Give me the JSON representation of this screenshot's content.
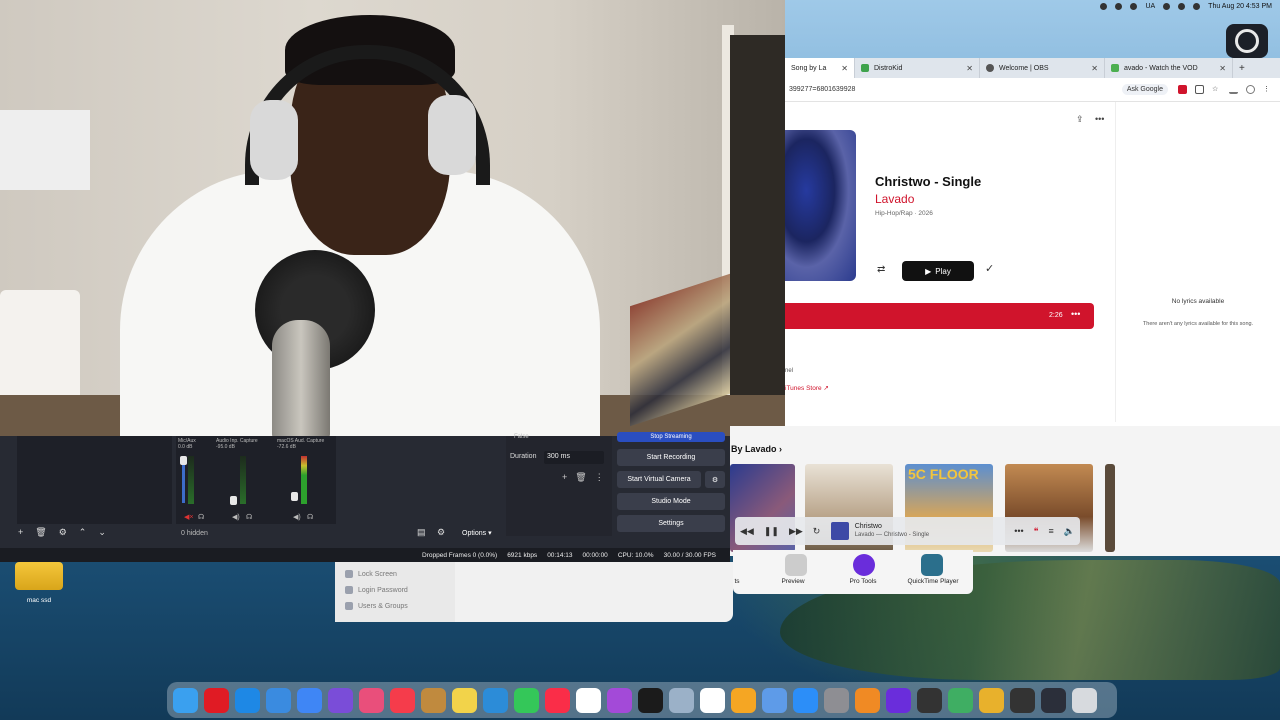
{
  "menubar": {
    "time": "Thu Aug 20  4:53 PM",
    "lang": "UA"
  },
  "browser": {
    "tabs": [
      {
        "label": "Song by La",
        "color": "#d0142c"
      },
      {
        "label": "DistroKid",
        "color": "#3fa34d"
      },
      {
        "label": "Welcome | OBS",
        "color": "#555555"
      },
      {
        "label": "avado - Watch the VOD",
        "color": "#4caf50"
      }
    ],
    "url_fragment": "399277=6801639928",
    "ask_google": "Ask Google"
  },
  "album": {
    "title": "Christwo - Single",
    "artist": "Lavado",
    "genre_year": "Hip-Hop/Rap · 2026",
    "play_label": "Play",
    "track_duration": "2:26",
    "label_line": "nel",
    "itunes_link": "iTunes Store ↗"
  },
  "lyrics": {
    "title": "No lyrics available",
    "body": "There aren't any lyrics available for this song."
  },
  "more_by": {
    "heading": "By Lavado ›",
    "card_text": "5C FLOOR"
  },
  "miniplayer": {
    "title": "Christwo",
    "subtitle": "Lavado — Christwo - Single"
  },
  "obs": {
    "mixer_channels": [
      {
        "name": "Mic/Aux",
        "db": "0.0 dB"
      },
      {
        "name": "Audio Inp. Capture",
        "db": "-95.0 dB"
      },
      {
        "name": "macOS Aud. Capture",
        "db": "-72.6 dB"
      }
    ],
    "hidden_label": "0 hidden",
    "options_label": "Options",
    "false_label": "False",
    "duration_label": "Duration",
    "duration_value": "300 ms",
    "buttons": {
      "stop_streaming": "Stop Streaming",
      "start_recording": "Start Recording",
      "start_virtual_camera": "Start Virtual Camera",
      "studio_mode": "Studio Mode",
      "settings": "Settings"
    },
    "status": {
      "dropped_frames": "Dropped Frames 0 (0.0%)",
      "bitrate": "6921 kbps",
      "stream_time": "00:14:13",
      "rec_time": "00:00:00",
      "cpu": "CPU: 10.0%",
      "fps": "30.00 / 30.00 FPS"
    }
  },
  "settings_win": {
    "items": [
      "Lock Screen",
      "Login Password",
      "Users & Groups"
    ]
  },
  "launcher": {
    "apps": [
      "ts",
      "Preview",
      "Pro Tools",
      "QuickTime Player"
    ]
  },
  "desktop": {
    "drive_label": "mac ssd"
  },
  "dock": {
    "icons": [
      {
        "name": "finder-icon",
        "color": "#3aa0ef"
      },
      {
        "name": "opera-icon",
        "color": "#e01b24"
      },
      {
        "name": "circle-app-icon",
        "color": "#1e88e5"
      },
      {
        "name": "safari-icon",
        "color": "#3a8be0"
      },
      {
        "name": "mail-icon",
        "color": "#3f86f5"
      },
      {
        "name": "siri-icon",
        "color": "#7a4dd8"
      },
      {
        "name": "launchpad-icon",
        "color": "#e94f7b"
      },
      {
        "name": "news-icon",
        "color": "#f53c4b"
      },
      {
        "name": "notes-brown-icon",
        "color": "#c08a3e"
      },
      {
        "name": "notes-icon",
        "color": "#f2d34a"
      },
      {
        "name": "freeform-icon",
        "color": "#2c8cd8"
      },
      {
        "name": "facetime-icon",
        "color": "#34c759"
      },
      {
        "name": "music-icon",
        "color": "#fa2d48"
      },
      {
        "name": "calendar-icon",
        "color": "#ffffff"
      },
      {
        "name": "podcasts-icon",
        "color": "#a34ad8"
      },
      {
        "name": "tv-icon",
        "color": "#1b1b1b"
      },
      {
        "name": "help-icon",
        "color": "#9bb1c8"
      },
      {
        "name": "reminders-icon",
        "color": "#ffffff"
      },
      {
        "name": "photos-icon",
        "color": "#f5a623"
      },
      {
        "name": "keychain-icon",
        "color": "#5e9be8"
      },
      {
        "name": "app-store-icon",
        "color": "#2c8ef8"
      },
      {
        "name": "system-settings-icon",
        "color": "#8e8e93"
      },
      {
        "name": "books-icon",
        "color": "#f08a24"
      },
      {
        "name": "pro-tools-icon",
        "color": "#6a2ddb"
      },
      {
        "name": "audio-app-icon",
        "color": "#333333"
      },
      {
        "name": "capcut-icon",
        "color": "#3fae63"
      },
      {
        "name": "chrome-icon",
        "color": "#e8b12c"
      },
      {
        "name": "automator-icon",
        "color": "#333333"
      },
      {
        "name": "obs-icon",
        "color": "#2b2f3a"
      },
      {
        "name": "trash-icon",
        "color": "#d7dade"
      }
    ]
  }
}
